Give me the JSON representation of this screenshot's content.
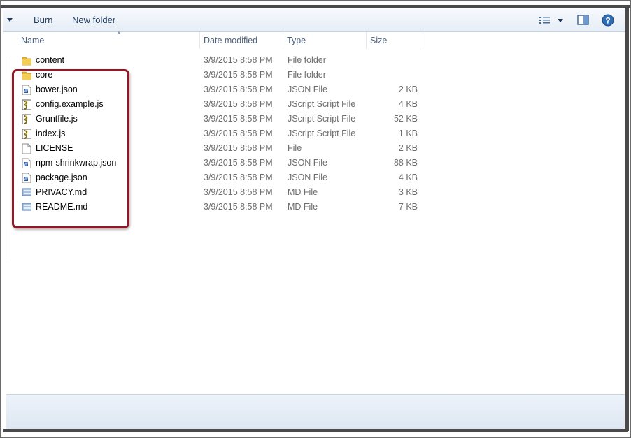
{
  "toolbar": {
    "burn_label": "Burn",
    "new_folder_label": "New folder",
    "icons": [
      "organize-dropdown-arrow-icon",
      "change-view-icon",
      "view-dropdown-arrow-icon",
      "preview-pane-icon",
      "help-icon"
    ]
  },
  "columns": {
    "name": "Name",
    "date_modified": "Date modified",
    "type": "Type",
    "size": "Size"
  },
  "files": [
    {
      "name": "content",
      "date": "3/9/2015 8:58 PM",
      "type": "File folder",
      "size": "",
      "icon": "folder-icon"
    },
    {
      "name": "core",
      "date": "3/9/2015 8:58 PM",
      "type": "File folder",
      "size": "",
      "icon": "folder-icon"
    },
    {
      "name": "bower.json",
      "date": "3/9/2015 8:58 PM",
      "type": "JSON File",
      "size": "2 KB",
      "icon": "json-file-icon"
    },
    {
      "name": "config.example.js",
      "date": "3/9/2015 8:58 PM",
      "type": "JScript Script File",
      "size": "4 KB",
      "icon": "script-file-icon"
    },
    {
      "name": "Gruntfile.js",
      "date": "3/9/2015 8:58 PM",
      "type": "JScript Script File",
      "size": "52 KB",
      "icon": "script-file-icon"
    },
    {
      "name": "index.js",
      "date": "3/9/2015 8:58 PM",
      "type": "JScript Script File",
      "size": "1 KB",
      "icon": "script-file-icon"
    },
    {
      "name": "LICENSE",
      "date": "3/9/2015 8:58 PM",
      "type": "File",
      "size": "2 KB",
      "icon": "blank-file-icon"
    },
    {
      "name": "npm-shrinkwrap.json",
      "date": "3/9/2015 8:58 PM",
      "type": "JSON File",
      "size": "88 KB",
      "icon": "json-file-icon"
    },
    {
      "name": "package.json",
      "date": "3/9/2015 8:58 PM",
      "type": "JSON File",
      "size": "4 KB",
      "icon": "json-file-icon"
    },
    {
      "name": "PRIVACY.md",
      "date": "3/9/2015 8:58 PM",
      "type": "MD File",
      "size": "3 KB",
      "icon": "md-file-icon"
    },
    {
      "name": "README.md",
      "date": "3/9/2015 8:58 PM",
      "type": "MD File",
      "size": "7 KB",
      "icon": "md-file-icon"
    }
  ],
  "colors": {
    "highlight_border": "#8f1a26",
    "toolbar_text": "#1e395b",
    "header_text": "#4c607a",
    "folder": "#e8b93a"
  }
}
